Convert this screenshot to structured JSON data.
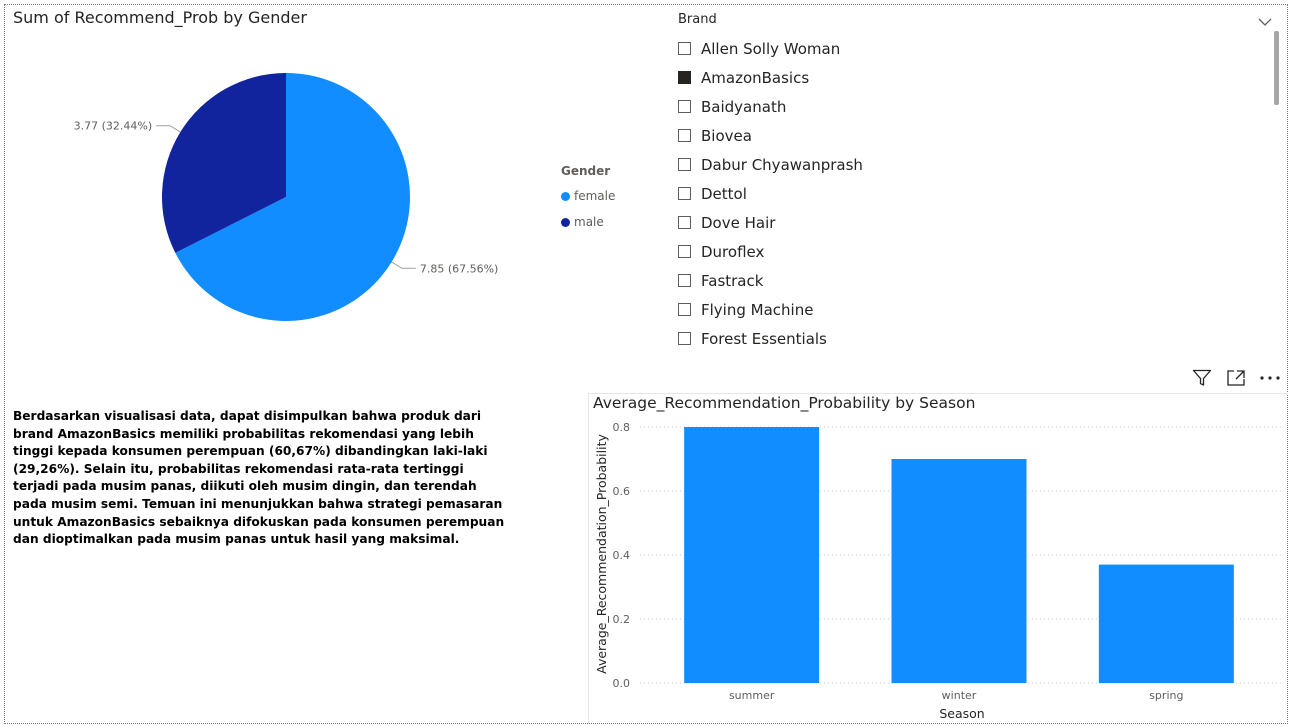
{
  "pie": {
    "title": "Sum of Recommend_Prob by Gender",
    "legend_title": "Gender",
    "slices": [
      {
        "name": "female",
        "value": 7.85,
        "label": "7.85 (67.56%)",
        "color": "#118DFF"
      },
      {
        "name": "male",
        "value": 3.77,
        "label": "3.77 (32.44%)",
        "color": "#12239E"
      }
    ]
  },
  "slicer": {
    "header": "Brand",
    "items": [
      {
        "label": "Allen Solly Woman",
        "checked": false
      },
      {
        "label": "AmazonBasics",
        "checked": true
      },
      {
        "label": "Baidyanath",
        "checked": false
      },
      {
        "label": "Biovea",
        "checked": false
      },
      {
        "label": "Dabur Chyawanprash",
        "checked": false
      },
      {
        "label": "Dettol",
        "checked": false
      },
      {
        "label": "Dove Hair",
        "checked": false
      },
      {
        "label": "Duroflex",
        "checked": false
      },
      {
        "label": "Fastrack",
        "checked": false
      },
      {
        "label": "Flying Machine",
        "checked": false
      },
      {
        "label": "Forest Essentials",
        "checked": false
      }
    ]
  },
  "narrative": {
    "text": "Berdasarkan visualisasi data, dapat disimpulkan bahwa produk dari brand AmazonBasics memiliki probabilitas rekomendasi yang lebih tinggi kepada konsumen perempuan (60,67%) dibandingkan laki-laki (29,26%). Selain itu, probabilitas rekomendasi rata-rata tertinggi terjadi pada musim panas, diikuti oleh musim dingin, dan terendah pada musim semi. Temuan ini menunjukkan bahwa strategi pemasaran untuk AmazonBasics sebaiknya difokuskan pada konsumen perempuan dan dioptimalkan pada musim panas untuk hasil yang maksimal."
  },
  "visual_header_icons": [
    "filter-icon",
    "focus-mode-icon",
    "more-options-icon"
  ],
  "chart_data": [
    {
      "type": "pie",
      "title": "Sum of Recommend_Prob by Gender",
      "legend_title": "Gender",
      "legend_position": "right",
      "categories": [
        "female",
        "male"
      ],
      "values": [
        7.85,
        3.77
      ],
      "percentages": [
        67.56,
        32.44
      ],
      "colors": [
        "#118DFF",
        "#12239E"
      ]
    },
    {
      "type": "bar",
      "title": "Average_Recommendation_Probability by Season",
      "xlabel": "Season",
      "ylabel": "Average_Recommendation_Probability",
      "categories": [
        "summer",
        "winter",
        "spring"
      ],
      "values": [
        0.8,
        0.7,
        0.37
      ],
      "ylim": [
        0,
        0.8
      ],
      "yticks": [
        "0.0",
        "0.2",
        "0.4",
        "0.6",
        "0.8"
      ],
      "grid": true,
      "color": "#118DFF"
    }
  ]
}
